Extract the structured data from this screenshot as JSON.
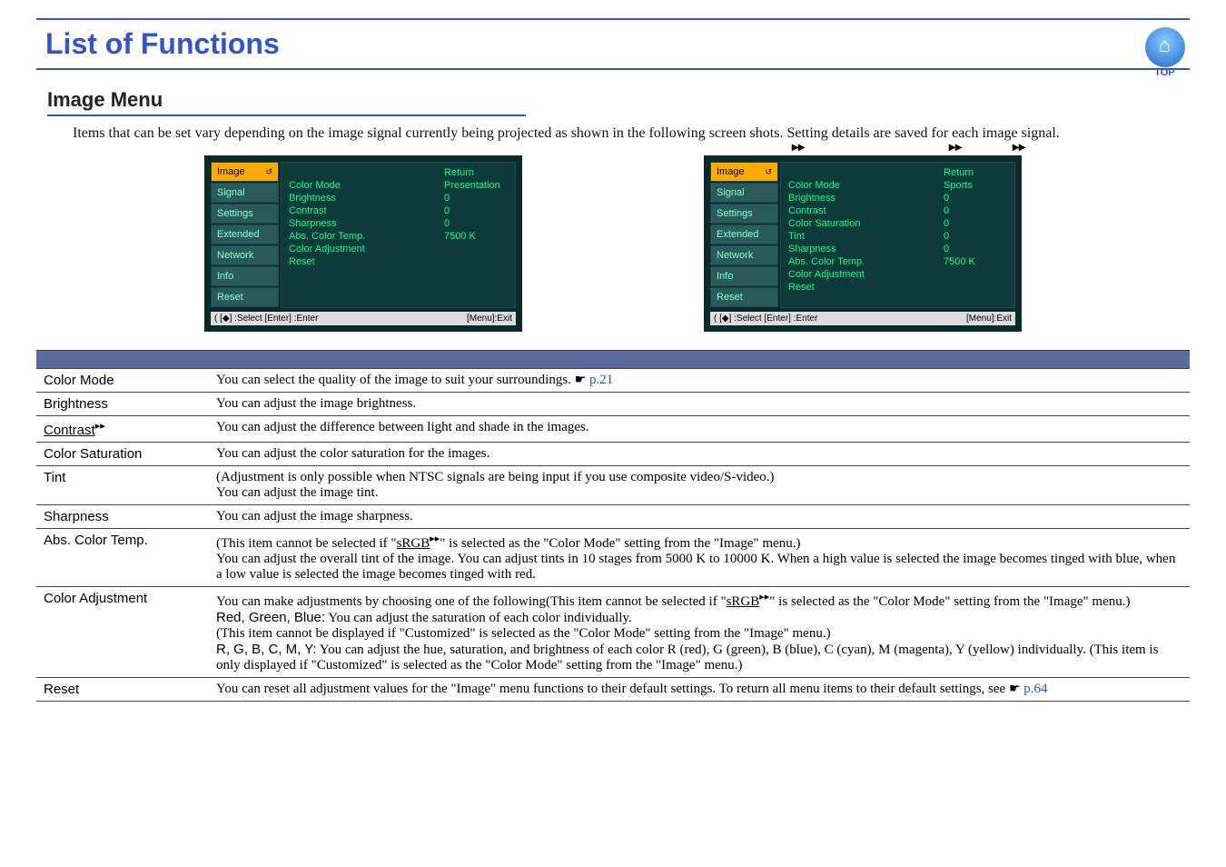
{
  "header": {
    "title": "List of Functions",
    "top_label": "TOP"
  },
  "section": {
    "heading": "Image Menu",
    "intro": "Items that can be set vary depending on the image signal currently being projected as shown in the following screen shots. Setting details are saved for each image signal."
  },
  "shot_common": {
    "return": "Return",
    "cats": [
      "Image",
      "Signal",
      "Settings",
      "Extended",
      "Network",
      "Info",
      "Reset"
    ],
    "footer_left": "( [◆] :Select  [Enter] :Enter",
    "footer_right": "[Menu]:Exit"
  },
  "shot1": {
    "rows": [
      {
        "k": "Color Mode",
        "v": "Presentation"
      },
      {
        "k": "Brightness",
        "v": "0"
      },
      {
        "k": "Contrast",
        "v": "0"
      },
      {
        "k": "Sharpness",
        "v": "0"
      },
      {
        "k": "Abs. Color Temp.",
        "v": "7500 K"
      },
      {
        "k": "Color Adjustment",
        "v": ""
      },
      {
        "k": "Reset",
        "v": ""
      }
    ]
  },
  "shot2": {
    "rows": [
      {
        "k": "Color Mode",
        "v": "Sports"
      },
      {
        "k": "Brightness",
        "v": "0"
      },
      {
        "k": "Contrast",
        "v": "0"
      },
      {
        "k": "Color Saturation",
        "v": "0"
      },
      {
        "k": "Tint",
        "v": "0"
      },
      {
        "k": "Sharpness",
        "v": "0"
      },
      {
        "k": "Abs. Color Temp.",
        "v": "7500 K"
      },
      {
        "k": "Color Adjustment",
        "v": ""
      },
      {
        "k": "Reset",
        "v": ""
      }
    ]
  },
  "glossary_marker": "▸▸",
  "table": {
    "rows": [
      {
        "name": "Color Mode",
        "gloss": false,
        "desc_parts": [
          {
            "t": "text",
            "v": "You can select the quality of the image to suit your surroundings. "
          },
          {
            "t": "hand"
          },
          {
            "t": "link",
            "v": " p.21"
          }
        ]
      },
      {
        "name": "Brightness",
        "gloss": false,
        "desc_parts": [
          {
            "t": "text",
            "v": "You can adjust the image brightness."
          }
        ]
      },
      {
        "name": "Contrast",
        "gloss": true,
        "underline": true,
        "desc_parts": [
          {
            "t": "text",
            "v": "You can adjust the difference between light and shade in the images."
          }
        ]
      },
      {
        "name": "Color Saturation",
        "gloss": false,
        "desc_parts": [
          {
            "t": "text",
            "v": "You can adjust the color saturation for the images."
          }
        ]
      },
      {
        "name": "Tint",
        "gloss": false,
        "desc_parts": [
          {
            "t": "text",
            "v": "(Adjustment is only possible when NTSC signals are being input if you use composite video/S-video.)"
          },
          {
            "t": "br"
          },
          {
            "t": "text",
            "v": "You can adjust the image tint."
          }
        ]
      },
      {
        "name": "Sharpness",
        "gloss": false,
        "desc_parts": [
          {
            "t": "text",
            "v": "You can adjust the image sharpness."
          }
        ]
      },
      {
        "name": "Abs. Color Temp.",
        "gloss": false,
        "desc_parts": [
          {
            "t": "text",
            "v": "(This item cannot be selected if \""
          },
          {
            "t": "uline",
            "v": "sRGB"
          },
          {
            "t": "gloss"
          },
          {
            "t": "text",
            "v": "\" is selected as the \"Color Mode\" setting from the \"Image\" menu.)"
          },
          {
            "t": "br"
          },
          {
            "t": "text",
            "v": "You can adjust the overall tint of the image. You can adjust tints in 10 stages from 5000 K to 10000 K. When a high value is selected the image becomes tinged with blue, when a low value is selected the image becomes tinged with red."
          }
        ]
      },
      {
        "name": "Color Adjustment",
        "gloss": false,
        "desc_parts": [
          {
            "t": "text",
            "v": "You can make adjustments by choosing one of the following(This item cannot be selected if \""
          },
          {
            "t": "uline",
            "v": "sRGB"
          },
          {
            "t": "gloss"
          },
          {
            "t": "text",
            "v": "\" is selected as the \"Color Mode\" setting from the \"Image\" menu.)"
          },
          {
            "t": "br"
          },
          {
            "t": "sans",
            "v": "Red, Green, Blue:"
          },
          {
            "t": "text",
            "v": " You can adjust the saturation of each color individually."
          },
          {
            "t": "br"
          },
          {
            "t": "text",
            "v": "  (This item cannot be displayed if \"Customized\" is selected as the \"Color Mode\" setting from the \"Image\" menu.)"
          },
          {
            "t": "br"
          },
          {
            "t": "sans",
            "v": "R, G, B, C, M, Y:"
          },
          {
            "t": "text",
            "v": " You can adjust the hue, saturation, and brightness of each color R (red), G (green), B (blue), C (cyan), M (magenta), Y (yellow) individually. (This item is only displayed if \"Customized\" is selected as the \"Color Mode\" setting from the \"Image\" menu.)"
          }
        ]
      },
      {
        "name": "Reset",
        "gloss": false,
        "desc_parts": [
          {
            "t": "text",
            "v": "You can reset all adjustment values for the \"Image\" menu functions to their default settings. To return all menu items to their default settings, see "
          },
          {
            "t": "hand"
          },
          {
            "t": "link",
            "v": " p.64"
          }
        ]
      }
    ]
  }
}
